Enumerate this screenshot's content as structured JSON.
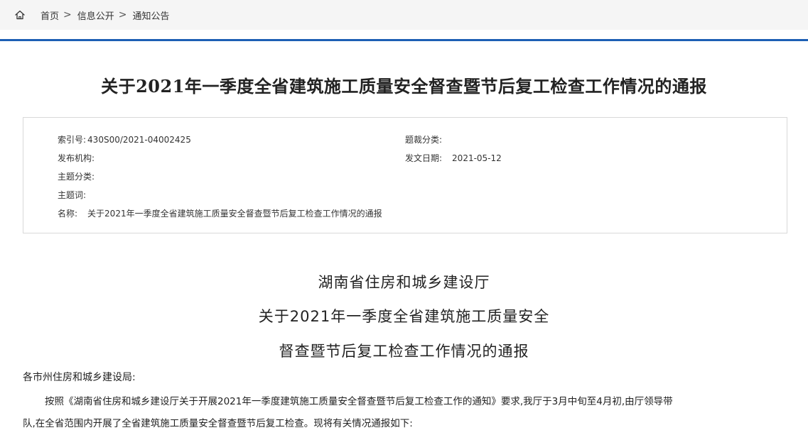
{
  "breadcrumb": {
    "items": [
      "首页",
      "信息公开",
      "通知公告"
    ],
    "separator": ">"
  },
  "article": {
    "title": "关于2021年一季度全省建筑施工质量安全督查暨节后复工检查工作情况的通报"
  },
  "meta": {
    "index_label": "索引号:",
    "index_value": "430S00/2021-04002425",
    "category_label": "题裁分类:",
    "category_value": "",
    "publisher_label": "发布机构:",
    "publisher_value": "",
    "date_label": "发文日期:",
    "date_value": "2021-05-12",
    "topic_label": "主题分类:",
    "topic_value": "",
    "keywords_label": "主题词:",
    "keywords_value": "",
    "name_label": "名称:",
    "name_value": "关于2021年一季度全省建筑施工质量安全督查暨节后复工检查工作情况的通报"
  },
  "document": {
    "heading_line1": "湖南省住房和城乡建设厅",
    "heading_line2": "关于2021年一季度全省建筑施工质量安全",
    "heading_line3": "督查暨节后复工检查工作情况的通报",
    "salutation": "各市州住房和城乡建设局:",
    "paragraph1_line1": "按照《湖南省住房和城乡建设厅关于开展2021年一季度建筑施工质量安全督查暨节后复工检查工作的通知》要求,我厅于3月中旬至4月初,由厅领导带",
    "paragraph1_line2": "队,在全省范围内开展了全省建筑施工质量安全督查暨节后复工检查。现将有关情况通报如下:"
  },
  "colors": {
    "accent": "#1d5fb4",
    "breadcrumb_bg": "#f5f5f5",
    "border": "#d9d9d9"
  },
  "icons": {
    "home": "home-icon"
  }
}
